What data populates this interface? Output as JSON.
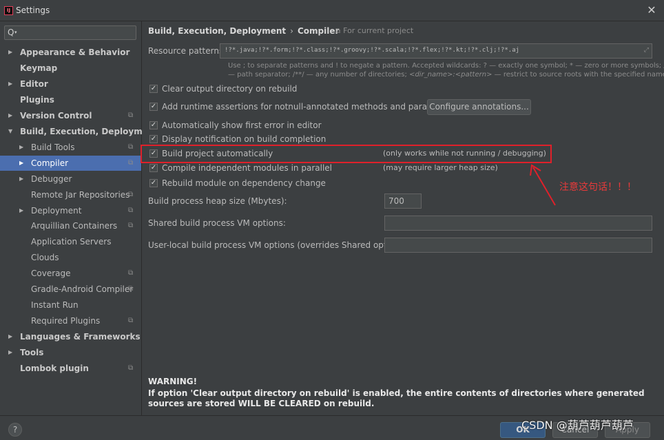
{
  "window": {
    "title": "Settings",
    "icon_text": "IJ",
    "close": "✕"
  },
  "sidebar": {
    "search_icon": "Q",
    "items": [
      {
        "label": "Appearance & Behavior",
        "level": 0,
        "arrow": "▶",
        "bold": true,
        "project": false
      },
      {
        "label": "Keymap",
        "level": 0,
        "arrow": "",
        "bold": true,
        "project": false
      },
      {
        "label": "Editor",
        "level": 0,
        "arrow": "▶",
        "bold": true,
        "project": false
      },
      {
        "label": "Plugins",
        "level": 0,
        "arrow": "",
        "bold": true,
        "project": false
      },
      {
        "label": "Version Control",
        "level": 0,
        "arrow": "▶",
        "bold": true,
        "project": true
      },
      {
        "label": "Build, Execution, Deployment",
        "level": 0,
        "arrow": "▼",
        "bold": true,
        "project": false
      },
      {
        "label": "Build Tools",
        "level": 1,
        "arrow": "▶",
        "bold": false,
        "project": true
      },
      {
        "label": "Compiler",
        "level": 1,
        "arrow": "▶",
        "bold": false,
        "project": true,
        "selected": true
      },
      {
        "label": "Debugger",
        "level": 1,
        "arrow": "▶",
        "bold": false,
        "project": false
      },
      {
        "label": "Remote Jar Repositories",
        "level": 1,
        "arrow": "",
        "bold": false,
        "project": true
      },
      {
        "label": "Deployment",
        "level": 1,
        "arrow": "▶",
        "bold": false,
        "project": true
      },
      {
        "label": "Arquillian Containers",
        "level": 1,
        "arrow": "",
        "bold": false,
        "project": true
      },
      {
        "label": "Application Servers",
        "level": 1,
        "arrow": "",
        "bold": false,
        "project": false
      },
      {
        "label": "Clouds",
        "level": 1,
        "arrow": "",
        "bold": false,
        "project": false
      },
      {
        "label": "Coverage",
        "level": 1,
        "arrow": "",
        "bold": false,
        "project": true
      },
      {
        "label": "Gradle-Android Compiler",
        "level": 1,
        "arrow": "",
        "bold": false,
        "project": true
      },
      {
        "label": "Instant Run",
        "level": 1,
        "arrow": "",
        "bold": false,
        "project": false
      },
      {
        "label": "Required Plugins",
        "level": 1,
        "arrow": "",
        "bold": false,
        "project": true
      },
      {
        "label": "Languages & Frameworks",
        "level": 0,
        "arrow": "▶",
        "bold": true,
        "project": false
      },
      {
        "label": "Tools",
        "level": 0,
        "arrow": "▶",
        "bold": true,
        "project": false
      },
      {
        "label": "Lombok plugin",
        "level": 0,
        "arrow": "",
        "bold": true,
        "project": true
      }
    ]
  },
  "content": {
    "breadcrumb_parent": "Build, Execution, Deployment",
    "breadcrumb_sep": "›",
    "breadcrumb_current": "Compiler",
    "scope": "For current project",
    "resource_label": "Resource patterns:",
    "resource_value": "!?*.java;!?*.form;!?*.class;!?*.groovy;!?*.scala;!?*.flex;!?*.kt;!?*.clj;!?*.aj",
    "hint_line1": "Use ; to separate patterns and ! to negate a pattern. Accepted wildcards: ? — exactly one symbol; * — zero or more symbols; /",
    "hint_line2_a": "— path separator; /**/ — any number of directories; ",
    "hint_line2_b": "<dir_name>:<pattern>",
    "hint_line2_c": " — restrict to source roots with the specified name",
    "checkboxes": {
      "clear_output": "Clear output directory on rebuild",
      "runtime_assertions": "Add runtime assertions for notnull-annotated methods and parameters",
      "show_first_error": "Automatically show first error in editor",
      "display_notification": "Display notification on build completion",
      "build_automatically": "Build project automatically",
      "compile_parallel": "Compile independent modules in parallel",
      "rebuild_on_change": "Rebuild module on dependency change"
    },
    "configure_annotations": "Configure annotations...",
    "note_build_automatically": "(only works while not running / debugging)",
    "note_parallel": "(may require larger heap size)",
    "heap_label": "Build process heap size (Mbytes):",
    "heap_value": "700",
    "shared_vm_label": "Shared build process VM options:",
    "user_vm_label": "User-local build process VM options (overrides Shared options):",
    "annotation": "注意这句话！！！",
    "warning_title": "WARNING!",
    "warning_text": "If option 'Clear output directory on rebuild' is enabled, the entire contents of directories where generated sources are stored WILL BE CLEARED on rebuild."
  },
  "footer": {
    "help": "?",
    "ok": "OK",
    "cancel": "Cancel",
    "apply": "Apply",
    "watermark": "CSDN @葫芦葫芦葫芦"
  },
  "colors": {
    "selection": "#4b6eaf",
    "highlight_box": "#e0202a",
    "annotation": "#e83a3a"
  }
}
